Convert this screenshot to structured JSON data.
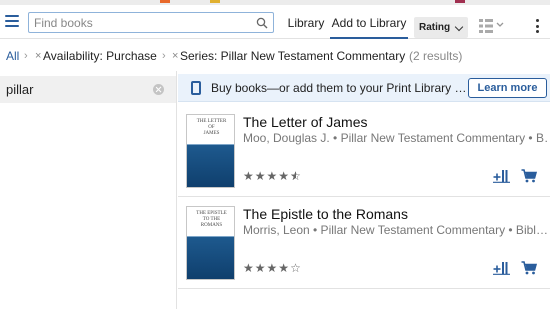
{
  "toolbar": {
    "search_placeholder": "Find books",
    "tabs": [
      {
        "label": "Library"
      },
      {
        "label": "Add to Library"
      }
    ],
    "sort_label": "Rating"
  },
  "breadcrumb": {
    "all_label": "All",
    "separator": "›",
    "remove_symbol": "×",
    "filters": [
      {
        "label": "Availability: Purchase"
      },
      {
        "label": "Series: Pillar New Testament Commentary"
      }
    ],
    "result_count": "(2 results)"
  },
  "filter_panel": {
    "value": "pillar"
  },
  "banner": {
    "text": "Buy books—or add them to your Print Library f…",
    "button_label": "Learn more"
  },
  "results": [
    {
      "title": "The Letter of James",
      "meta": "Moo, Douglas J. • Pillar New Testament Commentary • B…",
      "cover_text": [
        "THE LETTER",
        "OF",
        "JAMES"
      ],
      "rating": 4.5
    },
    {
      "title": "The Epistle to the Romans",
      "meta": "Morris, Leon • Pillar New Testament Commentary • Bibl…",
      "cover_text": [
        "THE EPISTLE",
        "TO THE",
        "ROMANS"
      ],
      "rating": 4
    }
  ],
  "colors": {
    "accent": "#2a5d9c",
    "banner_bg": "#eaf2fb",
    "star": "#666666"
  }
}
